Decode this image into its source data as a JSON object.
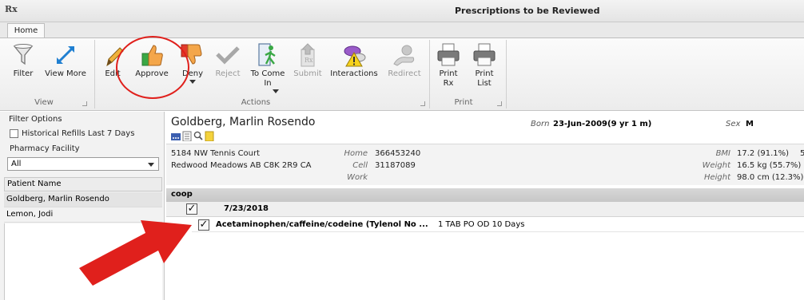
{
  "window": {
    "app_logo": "Rx",
    "title": "Prescriptions to be Reviewed"
  },
  "ribbon": {
    "tab": "Home",
    "buttons": {
      "filter": "Filter",
      "view_more": "View More",
      "edit": "Edit",
      "approve": "Approve",
      "deny": "Deny",
      "reject": "Reject",
      "to_come_in_1": "To Come",
      "to_come_in_2": "In",
      "submit": "Submit",
      "interactions": "Interactions",
      "redirect": "Redirect",
      "print_rx_1": "Print",
      "print_rx_2": "Rx",
      "print_list_1": "Print",
      "print_list_2": "List"
    },
    "groups": {
      "view": "View",
      "actions": "Actions",
      "print": "Print"
    }
  },
  "filter": {
    "title": "Filter Options",
    "historical_refills": "Historical Refills Last 7 Days",
    "pharmacy_label": "Pharmacy Facility",
    "pharmacy_value": "All",
    "column_header": "Patient Name",
    "patients": [
      "Goldberg, Marlin Rosendo",
      "Lemon, Jodi"
    ]
  },
  "patient": {
    "name": "Goldberg, Marlin Rosendo",
    "born_label": "Born",
    "born_value": "23-Jun-2009(9 yr 1 m)",
    "sex_label": "Sex",
    "sex_value": "M",
    "address_1": "5184 NW Tennis Court",
    "address_2": "Redwood Meadows AB  C8K 2R9  CA",
    "home_label": "Home",
    "home_value": "366453240",
    "cell_label": "Cell",
    "cell_value": "31187089",
    "work_label": "Work",
    "bmi_label": "BMI",
    "bmi_value": "17.2 (91.1%)",
    "weight_label": "Weight",
    "weight_value": "16.5 kg (55.7%)",
    "height_label": "Height",
    "height_value": "98.0 cm (12.3%)",
    "trunc": "5"
  },
  "rx": {
    "group": "coop",
    "date": "7/23/2018",
    "check_mark": "✓",
    "drug": "Acetaminophen/caffeine/codeine (Tylenol No ...",
    "sig": "1 TAB PO OD 10 Days"
  },
  "colors": {
    "accent_red": "#e0201c",
    "approve_green": "#3aa845",
    "deny_red": "#e23a2a"
  }
}
